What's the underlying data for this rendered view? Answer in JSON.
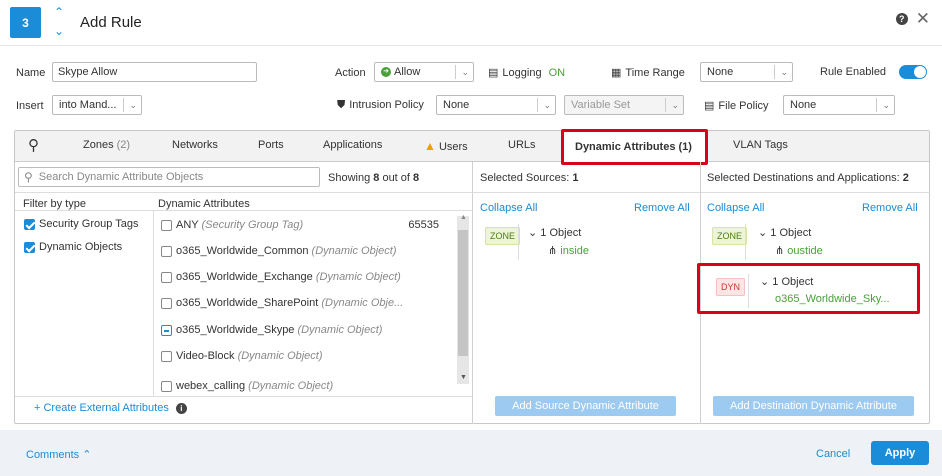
{
  "header": {
    "step": "3",
    "title": "Add Rule",
    "help_icon": "help-circle-icon",
    "close_icon": "close-icon"
  },
  "form": {
    "name_label": "Name",
    "name_value": "Skype Allow",
    "action_label": "Action",
    "action_value": "Allow",
    "logging_label": "Logging",
    "logging_value": "ON",
    "time_range_label": "Time Range",
    "time_range_value": "None",
    "rule_enabled_label": "Rule Enabled",
    "insert_label": "Insert",
    "insert_value": "into Mand...",
    "intrusion_label": "Intrusion Policy",
    "intrusion_value": "None",
    "variable_set_value": "Variable Set",
    "file_policy_label": "File Policy",
    "file_policy_value": "None"
  },
  "tabs": [
    {
      "label": "Zones",
      "count": "(2)"
    },
    {
      "label": "Networks"
    },
    {
      "label": "Ports"
    },
    {
      "label": "Applications"
    },
    {
      "label": "Users"
    },
    {
      "label": "URLs"
    },
    {
      "label": "Dynamic Attributes (1)"
    },
    {
      "label": "VLAN Tags"
    }
  ],
  "left": {
    "search_placeholder": "Search Dynamic Attribute Objects",
    "showing_prefix": "Showing ",
    "showing_count": "8",
    "showing_mid": " out of ",
    "showing_total": "8",
    "filter_header": "Filter by type",
    "attr_header": "Dynamic Attributes",
    "filters": [
      "Security Group Tags",
      "Dynamic Objects"
    ],
    "items": [
      {
        "name": "ANY",
        "type": "(Security Group Tag)",
        "num": "65535"
      },
      {
        "name": "o365_Worldwide_Common",
        "type": "(Dynamic Object)"
      },
      {
        "name": "o365_Worldwide_Exchange",
        "type": "(Dynamic Object)"
      },
      {
        "name": "o365_Worldwide_SharePoint",
        "type": "(Dynamic Obje..."
      },
      {
        "name": "o365_Worldwide_Skype",
        "type": "(Dynamic Object)"
      },
      {
        "name": "Video-Block",
        "type": "(Dynamic Object)"
      },
      {
        "name": "webex_calling",
        "type": "(Dynamic Object)"
      }
    ],
    "create_link": "+ Create External Attributes"
  },
  "sources": {
    "header_prefix": "Selected Sources: ",
    "header_count": "1",
    "collapse": "Collapse All",
    "remove": "Remove All",
    "tag": "ZONE",
    "group": "1 Object",
    "value": "inside",
    "add_button": "Add Source Dynamic Attribute"
  },
  "destinations": {
    "header_prefix": "Selected Destinations and Applications: ",
    "header_count": "2",
    "collapse": "Collapse All",
    "remove": "Remove All",
    "zone_tag": "ZONE",
    "zone_group": "1 Object",
    "zone_value": "oustide",
    "dyn_tag": "DYN",
    "dyn_group": "1 Object",
    "dyn_value": "o365_Worldwide_Sky...",
    "add_button": "Add Destination Dynamic Attribute"
  },
  "footer": {
    "comments": "Comments",
    "cancel": "Cancel",
    "apply": "Apply"
  },
  "colors": {
    "accent": "#1a8cd8",
    "highlight": "#d9001b",
    "success": "#4aa03a"
  }
}
